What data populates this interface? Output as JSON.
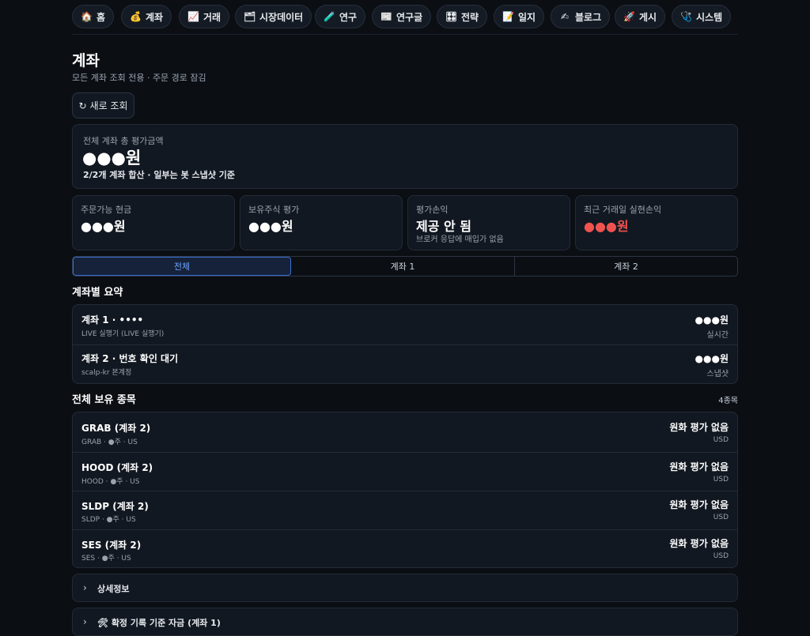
{
  "nav": [
    {
      "icon": "🏠",
      "icon_name": "home-icon",
      "label": "홈"
    },
    {
      "icon": "💰",
      "icon_name": "money-bag-icon",
      "label": "계좌"
    },
    {
      "icon": "📈",
      "icon_name": "chart-up-icon",
      "label": "거래"
    },
    {
      "icon": "🗂",
      "icon_name": "folder-icon",
      "label": "시장데이터"
    },
    {
      "icon": "🧪",
      "icon_name": "test-tube-icon",
      "label": "연구"
    },
    {
      "icon": "📰",
      "icon_name": "newspaper-icon",
      "label": "연구글"
    },
    {
      "icon": "🎛",
      "icon_name": "control-knobs-icon",
      "label": "전략"
    },
    {
      "icon": "📝",
      "icon_name": "memo-icon",
      "label": "일지"
    },
    {
      "icon": "✍",
      "icon_name": "writing-hand-icon",
      "label": "블로그"
    },
    {
      "icon": "🚀",
      "icon_name": "rocket-icon",
      "label": "게시"
    },
    {
      "icon": "🩺",
      "icon_name": "stethoscope-icon",
      "label": "시스템"
    }
  ],
  "page": {
    "title": "계좌",
    "subtitle": "모든 계좌 조회 전용 · 주문 경로 잠김",
    "refresh_icon": "↻",
    "refresh_label": "새로 조회"
  },
  "total": {
    "label": "전체 계좌 총 평가금액",
    "value": "●●●원",
    "note": "2/2개 계좌 합산 · 일부는 봇 스냅샷 기준"
  },
  "stats": [
    {
      "label": "주문가능 현금",
      "value": "●●●원",
      "sub": ""
    },
    {
      "label": "보유주식 평가",
      "value": "●●●원",
      "sub": ""
    },
    {
      "label": "평가손익",
      "value": "제공 안 됨",
      "sub": "브로커 응답에 매입가 없음"
    },
    {
      "label": "최근 거래일 실현손익",
      "value": "●●●원",
      "sub": ""
    }
  ],
  "tabs": [
    "전체",
    "계좌 1",
    "계좌 2"
  ],
  "summary": {
    "title": "계좌별 요약",
    "rows": [
      {
        "name": "계좌 1 · ••••",
        "meta": "LIVE 실행기 (LIVE 실행기)",
        "value": "●●●원",
        "status": "실시간"
      },
      {
        "name": "계좌 2 · 번호 확인 대기",
        "meta": "scalp-kr 본계정",
        "value": "●●●원",
        "status": "스냅샷"
      }
    ]
  },
  "holdings": {
    "title": "전체 보유 종목",
    "count": "4종목",
    "rows": [
      {
        "name": "GRAB (계좌 2)",
        "meta": "GRAB · ●주 · US",
        "value": "원화 평가 없음",
        "currency": "USD"
      },
      {
        "name": "HOOD (계좌 2)",
        "meta": "HOOD · ●주 · US",
        "value": "원화 평가 없음",
        "currency": "USD"
      },
      {
        "name": "SLDP (계좌 2)",
        "meta": "SLDP · ●주 · US",
        "value": "원화 평가 없음",
        "currency": "USD"
      },
      {
        "name": "SES (계좌 2)",
        "meta": "SES · ●주 · US",
        "value": "원화 평가 없음",
        "currency": "USD"
      }
    ]
  },
  "details": {
    "chevron": "›",
    "label": "상세정보"
  },
  "confirmed": {
    "chevron": "›",
    "icon": "🛠",
    "label": "확정 기록 기준 자금 (계좌 1)"
  },
  "colors": {
    "background": "#0b0f14",
    "card": "#121821",
    "accent": "#6aa3ff",
    "negative": "#ef5350"
  }
}
